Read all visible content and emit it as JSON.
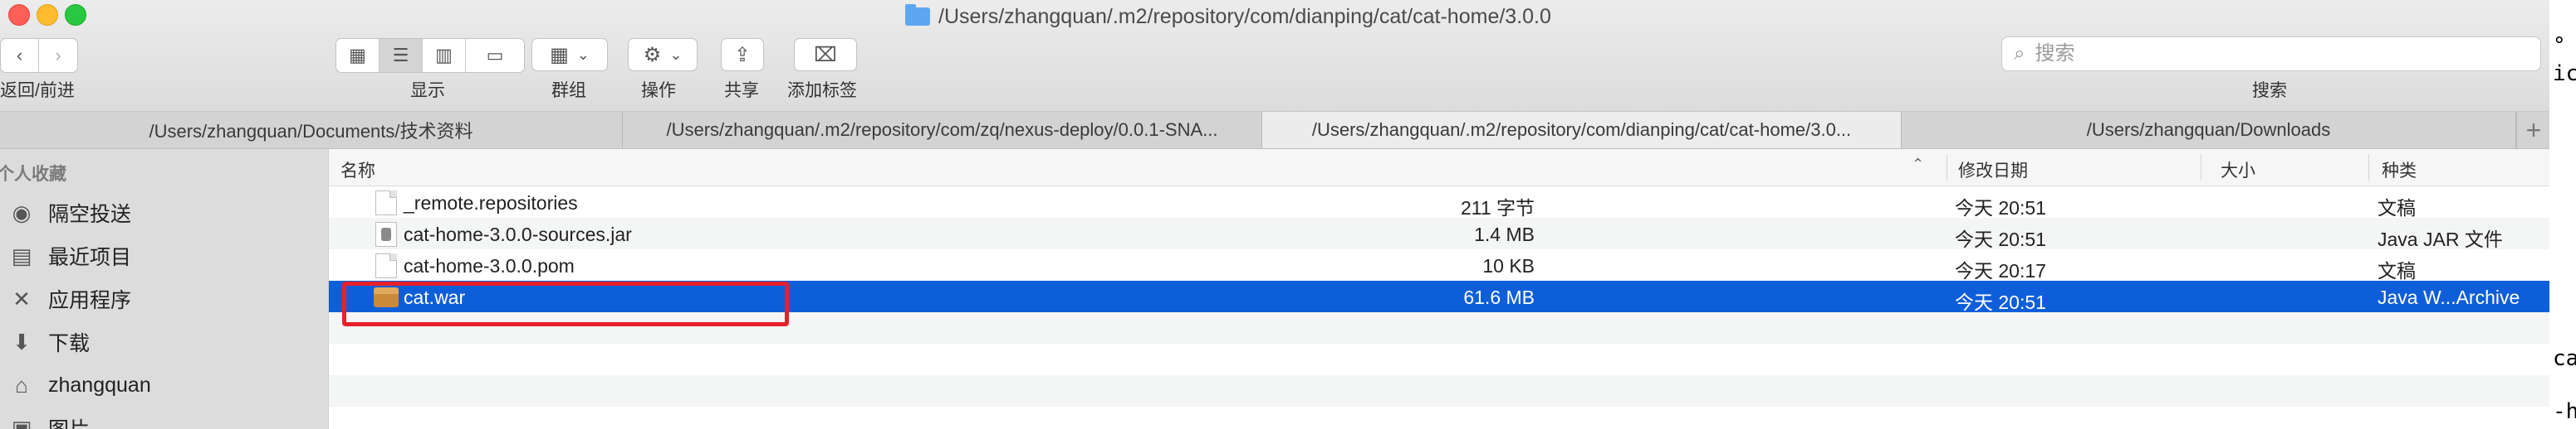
{
  "window": {
    "title": "/Users/zhangquan/.m2/repository/com/dianping/cat/cat-home/3.0.0"
  },
  "toolbar": {
    "back_forward_label": "返回/前进",
    "view_label": "显示",
    "group_label": "群组",
    "action_label": "操作",
    "share_label": "共享",
    "tags_label": "添加标签",
    "search_label": "搜索",
    "search_placeholder": "搜索"
  },
  "tabs": [
    {
      "label": "/Users/zhangquan/Documents/技术资料"
    },
    {
      "label": "/Users/zhangquan/.m2/repository/com/zq/nexus-deploy/0.0.1-SNA..."
    },
    {
      "label": "/Users/zhangquan/.m2/repository/com/dianping/cat/cat-home/3.0..."
    },
    {
      "label": "/Users/zhangquan/Downloads"
    }
  ],
  "sidebar": {
    "heading": "个人收藏",
    "items": [
      {
        "label": "隔空投送",
        "icon": "airdrop-icon"
      },
      {
        "label": "最近项目",
        "icon": "recents-icon"
      },
      {
        "label": "应用程序",
        "icon": "applications-icon"
      },
      {
        "label": "下载",
        "icon": "downloads-icon"
      },
      {
        "label": "zhangquan",
        "icon": "home-icon"
      },
      {
        "label": "图片",
        "icon": "pictures-icon"
      }
    ]
  },
  "columns": {
    "name": "名称",
    "date": "修改日期",
    "size": "大小",
    "kind": "种类"
  },
  "files": [
    {
      "name": "_remote.repositories",
      "date": "今天 20:51",
      "size": "211 字节",
      "kind": "文稿",
      "icon": "document-icon"
    },
    {
      "name": "cat-home-3.0.0-sources.jar",
      "date": "今天 20:51",
      "size": "1.4 MB",
      "kind": "Java JAR 文件",
      "icon": "jar-file-icon"
    },
    {
      "name": "cat-home-3.0.0.pom",
      "date": "今天 20:17",
      "size": "10 KB",
      "kind": "文稿",
      "icon": "document-icon"
    },
    {
      "name": "cat.war",
      "date": "今天 20:51",
      "size": "61.6 MB",
      "kind": "Java W...Archive",
      "icon": "war-archive-icon"
    }
  ],
  "right_edge_fragments": [
    "°",
    "ic",
    "ca",
    "-h"
  ],
  "colors": {
    "selection": "#0f5ed9",
    "highlight_box": "#e8202a"
  }
}
